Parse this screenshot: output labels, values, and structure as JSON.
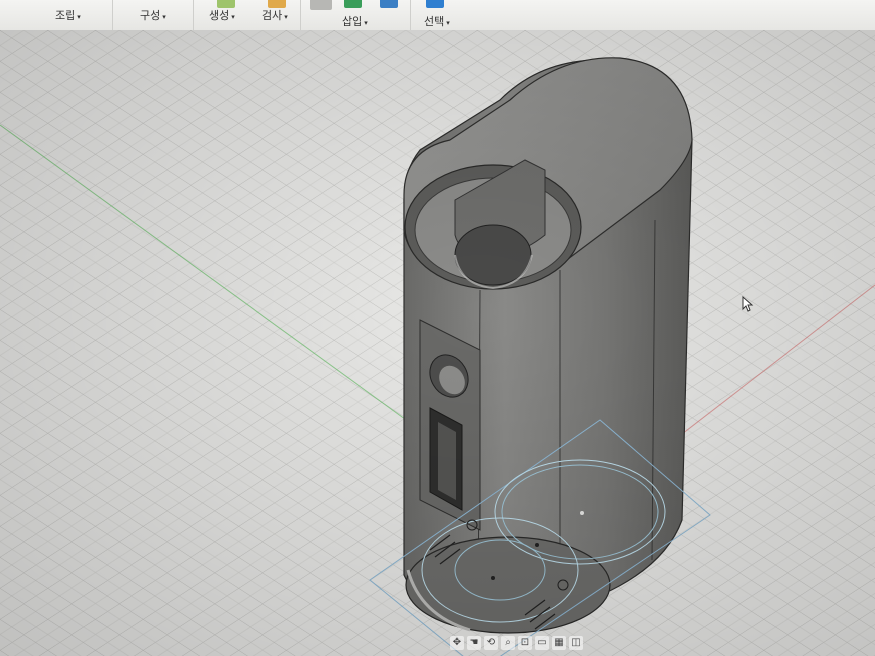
{
  "toolbar": {
    "groups": [
      {
        "label": "조립",
        "caret": "▾"
      },
      {
        "label": "구성",
        "caret": "▾"
      },
      {
        "label": "생성",
        "caret": "▾"
      },
      {
        "label": "검사",
        "caret": "▾"
      },
      {
        "label": "삽입",
        "caret": "▾"
      },
      {
        "label": "선택",
        "caret": "▾"
      }
    ]
  },
  "viewport": {
    "background": "#e9e9e7",
    "grid_color": "#b9b9b6",
    "model_color": "#7a7a78",
    "axis_colors": {
      "x": "#d46a6a",
      "y": "#6abf6a"
    }
  },
  "navbar": {
    "icons": [
      "move-icon",
      "pan-icon",
      "orbit-icon",
      "zoom-icon",
      "fit-icon",
      "display-icon",
      "grid-icon",
      "viewport-icon"
    ]
  }
}
